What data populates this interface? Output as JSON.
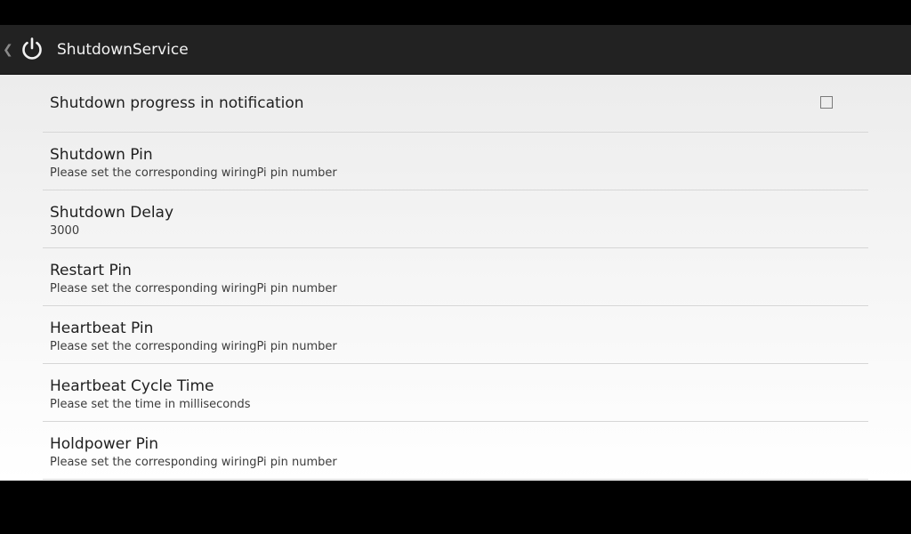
{
  "app": {
    "title": "ShutdownService",
    "icon": "power-icon",
    "back_icon": "chevron-left-icon",
    "back_glyph": "❮"
  },
  "preferences": {
    "notification": {
      "title": "Shutdown progress in notification",
      "checked": false
    },
    "items": [
      {
        "title": "Shutdown Pin",
        "summary": "Please set the corresponding wiringPi pin number"
      },
      {
        "title": "Shutdown Delay",
        "summary": "3000"
      },
      {
        "title": "Restart Pin",
        "summary": "Please set the corresponding wiringPi pin number"
      },
      {
        "title": "Heartbeat Pin",
        "summary": "Please set the corresponding wiringPi pin number"
      },
      {
        "title": "Heartbeat Cycle Time",
        "summary": "Please set the time in milliseconds"
      },
      {
        "title": "Holdpower Pin",
        "summary": "Please set the corresponding wiringPi pin number"
      }
    ]
  }
}
